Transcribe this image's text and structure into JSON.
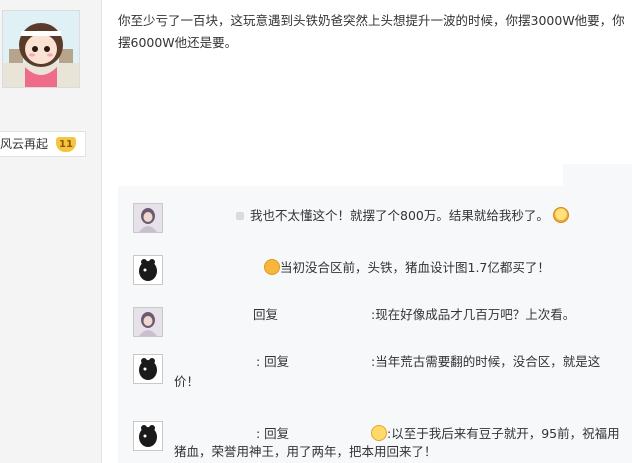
{
  "user": {
    "name": "风云再起",
    "level": "11"
  },
  "post": {
    "text": "你至少亏了一百块，这玩意遇到头铁奶爸突然上头想提升一波的时候，你摆3000W他要，你摆6000W他还是要。"
  },
  "replies": [
    {
      "text": "我也不太懂这个！就摆了个800万。结果就给我秒了。"
    },
    {
      "text": "当初没合区前，头铁，猪血设计图1.7亿都买了！"
    },
    {
      "prefix": "回复",
      "text": ":现在好像成品才几百万吧？上次看。"
    },
    {
      "prefix": ": 回复",
      "text": ":当年荒古需要翻的时候，没合区，就是这",
      "continuation": "价！"
    },
    {
      "prefix": ": 回复",
      "text": ":以至于我后来有豆子就开，95前，祝福用",
      "continuation": "猪血，荣誉用神王，用了两年，把本用回来了！"
    }
  ],
  "icons": {
    "laugh": "laugh-emoji-icon",
    "tongue": "tongue-emoji-icon",
    "smile": "smile-emoji-icon"
  }
}
